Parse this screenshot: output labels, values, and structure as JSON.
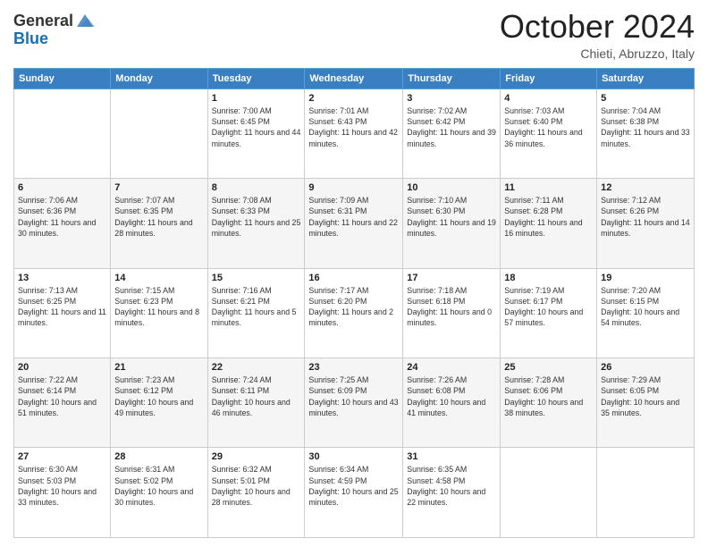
{
  "header": {
    "logo": {
      "line1": "General",
      "line2": "Blue"
    },
    "title": "October 2024",
    "location": "Chieti, Abruzzo, Italy"
  },
  "days_of_week": [
    "Sunday",
    "Monday",
    "Tuesday",
    "Wednesday",
    "Thursday",
    "Friday",
    "Saturday"
  ],
  "weeks": [
    [
      {
        "day": "",
        "sunrise": "",
        "sunset": "",
        "daylight": ""
      },
      {
        "day": "",
        "sunrise": "",
        "sunset": "",
        "daylight": ""
      },
      {
        "day": "1",
        "sunrise": "Sunrise: 7:00 AM",
        "sunset": "Sunset: 6:45 PM",
        "daylight": "Daylight: 11 hours and 44 minutes."
      },
      {
        "day": "2",
        "sunrise": "Sunrise: 7:01 AM",
        "sunset": "Sunset: 6:43 PM",
        "daylight": "Daylight: 11 hours and 42 minutes."
      },
      {
        "day": "3",
        "sunrise": "Sunrise: 7:02 AM",
        "sunset": "Sunset: 6:42 PM",
        "daylight": "Daylight: 11 hours and 39 minutes."
      },
      {
        "day": "4",
        "sunrise": "Sunrise: 7:03 AM",
        "sunset": "Sunset: 6:40 PM",
        "daylight": "Daylight: 11 hours and 36 minutes."
      },
      {
        "day": "5",
        "sunrise": "Sunrise: 7:04 AM",
        "sunset": "Sunset: 6:38 PM",
        "daylight": "Daylight: 11 hours and 33 minutes."
      }
    ],
    [
      {
        "day": "6",
        "sunrise": "Sunrise: 7:06 AM",
        "sunset": "Sunset: 6:36 PM",
        "daylight": "Daylight: 11 hours and 30 minutes."
      },
      {
        "day": "7",
        "sunrise": "Sunrise: 7:07 AM",
        "sunset": "Sunset: 6:35 PM",
        "daylight": "Daylight: 11 hours and 28 minutes."
      },
      {
        "day": "8",
        "sunrise": "Sunrise: 7:08 AM",
        "sunset": "Sunset: 6:33 PM",
        "daylight": "Daylight: 11 hours and 25 minutes."
      },
      {
        "day": "9",
        "sunrise": "Sunrise: 7:09 AM",
        "sunset": "Sunset: 6:31 PM",
        "daylight": "Daylight: 11 hours and 22 minutes."
      },
      {
        "day": "10",
        "sunrise": "Sunrise: 7:10 AM",
        "sunset": "Sunset: 6:30 PM",
        "daylight": "Daylight: 11 hours and 19 minutes."
      },
      {
        "day": "11",
        "sunrise": "Sunrise: 7:11 AM",
        "sunset": "Sunset: 6:28 PM",
        "daylight": "Daylight: 11 hours and 16 minutes."
      },
      {
        "day": "12",
        "sunrise": "Sunrise: 7:12 AM",
        "sunset": "Sunset: 6:26 PM",
        "daylight": "Daylight: 11 hours and 14 minutes."
      }
    ],
    [
      {
        "day": "13",
        "sunrise": "Sunrise: 7:13 AM",
        "sunset": "Sunset: 6:25 PM",
        "daylight": "Daylight: 11 hours and 11 minutes."
      },
      {
        "day": "14",
        "sunrise": "Sunrise: 7:15 AM",
        "sunset": "Sunset: 6:23 PM",
        "daylight": "Daylight: 11 hours and 8 minutes."
      },
      {
        "day": "15",
        "sunrise": "Sunrise: 7:16 AM",
        "sunset": "Sunset: 6:21 PM",
        "daylight": "Daylight: 11 hours and 5 minutes."
      },
      {
        "day": "16",
        "sunrise": "Sunrise: 7:17 AM",
        "sunset": "Sunset: 6:20 PM",
        "daylight": "Daylight: 11 hours and 2 minutes."
      },
      {
        "day": "17",
        "sunrise": "Sunrise: 7:18 AM",
        "sunset": "Sunset: 6:18 PM",
        "daylight": "Daylight: 11 hours and 0 minutes."
      },
      {
        "day": "18",
        "sunrise": "Sunrise: 7:19 AM",
        "sunset": "Sunset: 6:17 PM",
        "daylight": "Daylight: 10 hours and 57 minutes."
      },
      {
        "day": "19",
        "sunrise": "Sunrise: 7:20 AM",
        "sunset": "Sunset: 6:15 PM",
        "daylight": "Daylight: 10 hours and 54 minutes."
      }
    ],
    [
      {
        "day": "20",
        "sunrise": "Sunrise: 7:22 AM",
        "sunset": "Sunset: 6:14 PM",
        "daylight": "Daylight: 10 hours and 51 minutes."
      },
      {
        "day": "21",
        "sunrise": "Sunrise: 7:23 AM",
        "sunset": "Sunset: 6:12 PM",
        "daylight": "Daylight: 10 hours and 49 minutes."
      },
      {
        "day": "22",
        "sunrise": "Sunrise: 7:24 AM",
        "sunset": "Sunset: 6:11 PM",
        "daylight": "Daylight: 10 hours and 46 minutes."
      },
      {
        "day": "23",
        "sunrise": "Sunrise: 7:25 AM",
        "sunset": "Sunset: 6:09 PM",
        "daylight": "Daylight: 10 hours and 43 minutes."
      },
      {
        "day": "24",
        "sunrise": "Sunrise: 7:26 AM",
        "sunset": "Sunset: 6:08 PM",
        "daylight": "Daylight: 10 hours and 41 minutes."
      },
      {
        "day": "25",
        "sunrise": "Sunrise: 7:28 AM",
        "sunset": "Sunset: 6:06 PM",
        "daylight": "Daylight: 10 hours and 38 minutes."
      },
      {
        "day": "26",
        "sunrise": "Sunrise: 7:29 AM",
        "sunset": "Sunset: 6:05 PM",
        "daylight": "Daylight: 10 hours and 35 minutes."
      }
    ],
    [
      {
        "day": "27",
        "sunrise": "Sunrise: 6:30 AM",
        "sunset": "Sunset: 5:03 PM",
        "daylight": "Daylight: 10 hours and 33 minutes."
      },
      {
        "day": "28",
        "sunrise": "Sunrise: 6:31 AM",
        "sunset": "Sunset: 5:02 PM",
        "daylight": "Daylight: 10 hours and 30 minutes."
      },
      {
        "day": "29",
        "sunrise": "Sunrise: 6:32 AM",
        "sunset": "Sunset: 5:01 PM",
        "daylight": "Daylight: 10 hours and 28 minutes."
      },
      {
        "day": "30",
        "sunrise": "Sunrise: 6:34 AM",
        "sunset": "Sunset: 4:59 PM",
        "daylight": "Daylight: 10 hours and 25 minutes."
      },
      {
        "day": "31",
        "sunrise": "Sunrise: 6:35 AM",
        "sunset": "Sunset: 4:58 PM",
        "daylight": "Daylight: 10 hours and 22 minutes."
      },
      {
        "day": "",
        "sunrise": "",
        "sunset": "",
        "daylight": ""
      },
      {
        "day": "",
        "sunrise": "",
        "sunset": "",
        "daylight": ""
      }
    ]
  ]
}
